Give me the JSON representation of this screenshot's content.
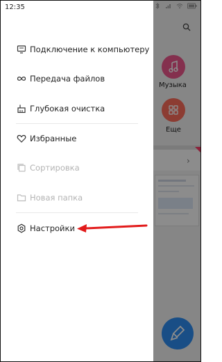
{
  "status_bar": {
    "time": "12:35"
  },
  "drawer": {
    "items": [
      {
        "label": "Подключение к компьютеру",
        "icon": "computer-icon",
        "enabled": true
      },
      {
        "label": "Передача файлов",
        "icon": "file-transfer-icon",
        "enabled": true
      },
      {
        "label": "Глубокая очистка",
        "icon": "broom-icon",
        "enabled": true
      },
      {
        "label": "Избранные",
        "icon": "heart-icon",
        "enabled": true
      },
      {
        "label": "Сортировка",
        "icon": "sort-icon",
        "enabled": false
      },
      {
        "label": "Новая папка",
        "icon": "new-folder-icon",
        "enabled": false
      },
      {
        "label": "Настройки",
        "icon": "settings-gear-icon",
        "enabled": true
      }
    ]
  },
  "background": {
    "music_label": "Музыка",
    "more_label": "Еще"
  },
  "colors": {
    "annotation_arrow": "#e21b1b",
    "music_tile": "#f0588e",
    "more_tile": "#ff6e5c",
    "fab": "#2e8ff4"
  }
}
